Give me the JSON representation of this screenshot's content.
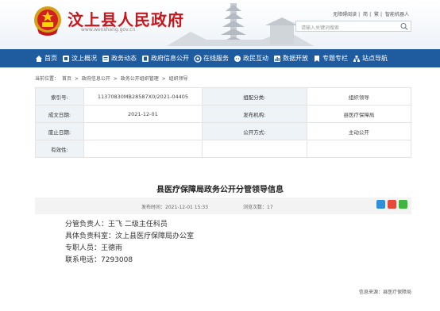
{
  "header": {
    "site_title": "汶上县人民政府",
    "site_url": "www.wenshang.gov.cn",
    "top_links": [
      "无障碍阅读",
      "简",
      "繁",
      "智能机器人"
    ],
    "search_placeholder": "请输入关键词搜索"
  },
  "nav": {
    "items": [
      {
        "label": "首页",
        "icon": "home-icon"
      },
      {
        "label": "汶上概况",
        "icon": "flag-icon"
      },
      {
        "label": "政务动态",
        "icon": "news-icon"
      },
      {
        "label": "政府信息公开",
        "icon": "building-icon"
      },
      {
        "label": "在线服务",
        "icon": "service-icon"
      },
      {
        "label": "政民互动",
        "icon": "chat-icon"
      },
      {
        "label": "数据开放",
        "icon": "data-icon"
      },
      {
        "label": "专题专栏",
        "icon": "topic-icon"
      },
      {
        "label": "站点导航",
        "icon": "sitemap-icon"
      }
    ]
  },
  "breadcrumb": [
    "当前位置：",
    "首页",
    ">",
    "政府信息公开",
    ">",
    "政务公开组织管理",
    ">",
    "组织领导"
  ],
  "info": {
    "index_label": "索引号:",
    "index_value": "11370830MB28587X0/2021-04405",
    "category_label": "组配分类:",
    "category_value": "组织领导",
    "date_label": "成文日期:",
    "date_value": "2021-12-01",
    "publisher_label": "发布机构:",
    "publisher_value": "县医疗保障局",
    "repeal_label": "废止日期:",
    "repeal_value": "",
    "method_label": "公开方式:",
    "method_value": "主动公开",
    "validity_label": "有效性:",
    "validity_value": ""
  },
  "article": {
    "title": "县医疗保障局政务公开分管领导信息",
    "date": "发布时间：2021-12-01 15:33",
    "views": "浏览次数：17",
    "lines": [
      "分管负责人：王飞  二级主任科员",
      "具体负责科室：汶上县医疗保障局办公室",
      "专职人员：王德雨",
      "联系电话：7293008"
    ],
    "source": "信息来源：县医疗保障局"
  },
  "colors": {
    "nav": "#1f5c9f",
    "title_red": "#c8161d",
    "label_bg": "#eef3f7"
  }
}
